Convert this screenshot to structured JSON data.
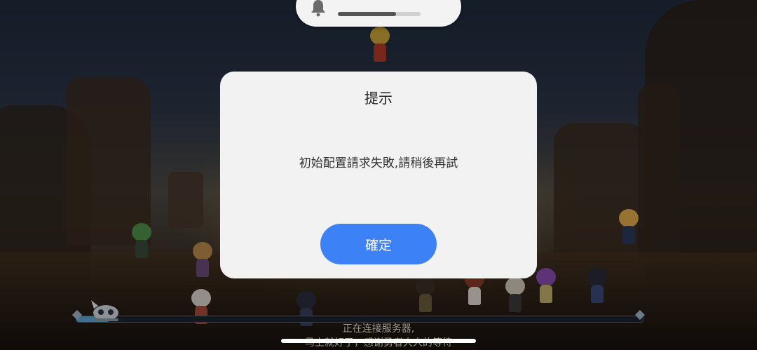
{
  "volume_hud": {
    "label": "铃声",
    "level": 0.7
  },
  "dialog": {
    "title": "提示",
    "message": "初始配置請求失敗,請稍後再試",
    "confirm_label": "確定"
  },
  "loading": {
    "status": "正在连接服务器,",
    "subtext": "马上就好了，感谢勇者大人的等待",
    "progress": 0.06
  },
  "colors": {
    "accent": "#3c82f6",
    "dialog_bg": "#f2f2f2"
  }
}
